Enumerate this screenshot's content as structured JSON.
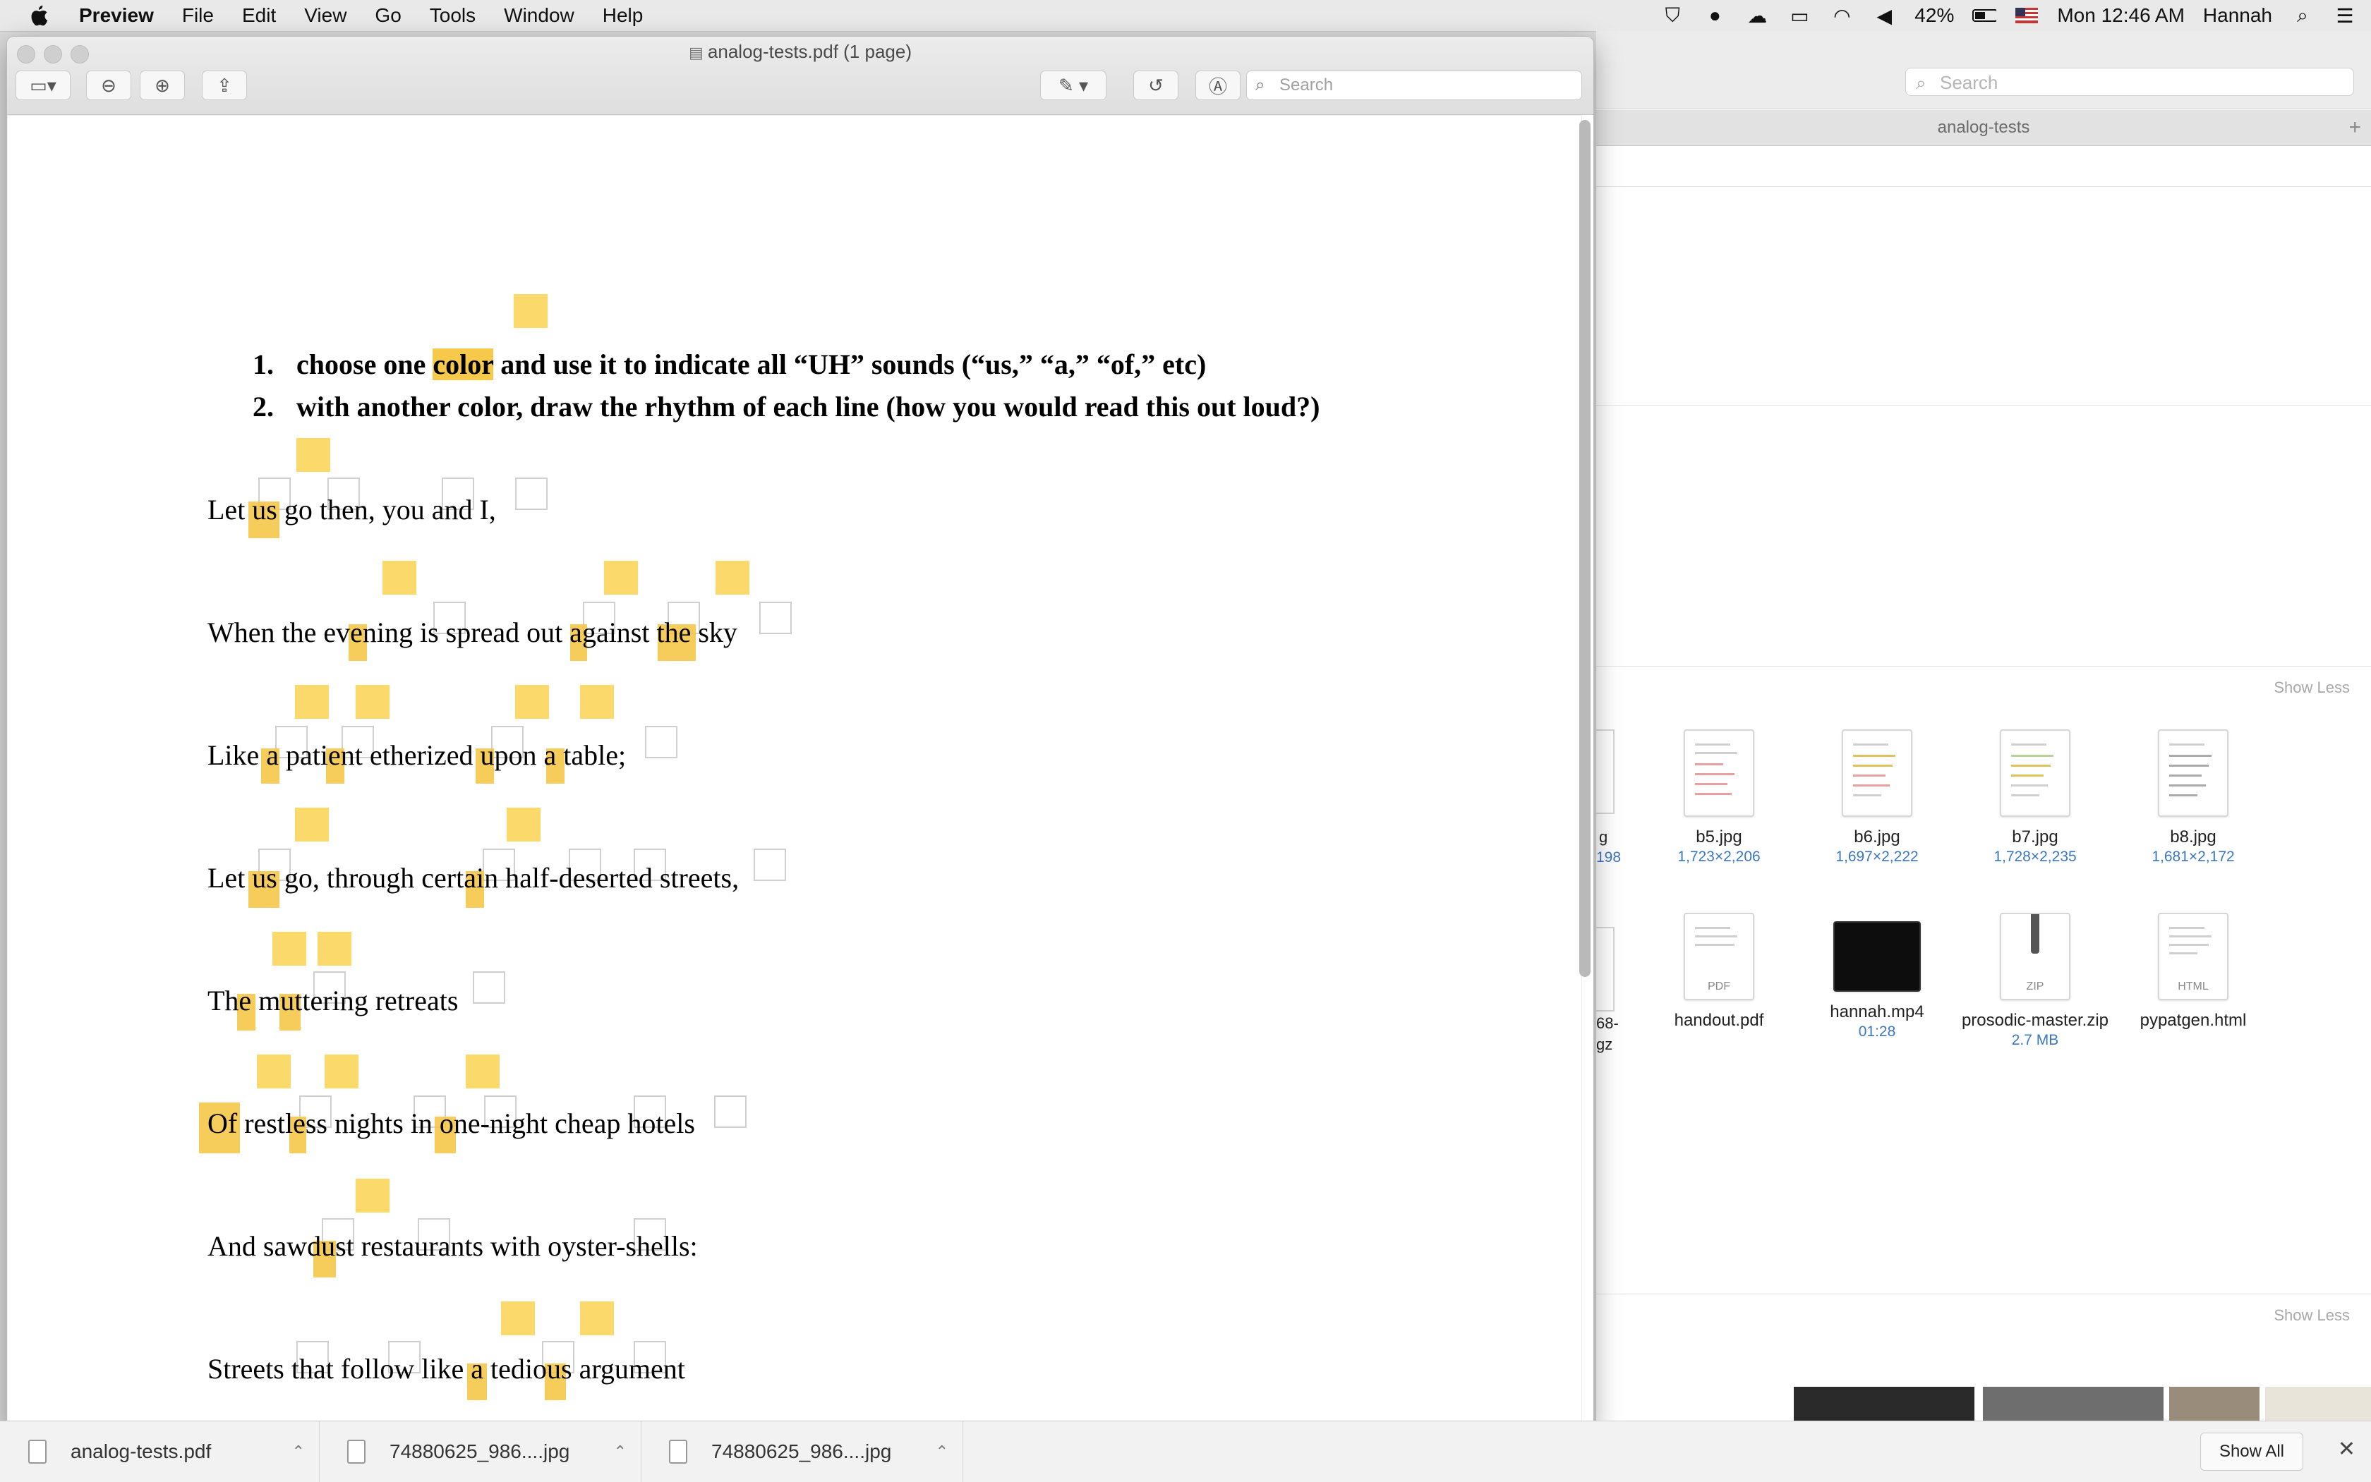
{
  "menubar": {
    "app_name": "Preview",
    "items": [
      "File",
      "Edit",
      "View",
      "Go",
      "Tools",
      "Window",
      "Help"
    ],
    "battery": "42%",
    "clock": "Mon 12:46 AM",
    "user": "Hannah"
  },
  "preview": {
    "title": "analog-tests.pdf (1 page)",
    "search_placeholder": "Search",
    "instructions": [
      {
        "num": "1.",
        "pre": "choose one ",
        "hl": "color",
        "post": " and use it to indicate all “UH” sounds (“us,” “a,” “of,” etc)"
      },
      {
        "num": "2.",
        "pre": "with another color, draw the rhythm of each line (how you would read this out loud?)",
        "hl": "",
        "post": ""
      }
    ],
    "poem_lines": [
      "Let us go then, you and I,",
      "When the evening is spread out against the sky",
      "Like a patient etherized upon a table;",
      "Let us go, through certain half-deserted streets,",
      "The muttering retreats",
      "Of restless nights in one-night cheap hotels",
      "And sawdust restaurants with oyster-shells:",
      "Streets that follow like a tedious argument"
    ]
  },
  "finder": {
    "search_placeholder": "Search",
    "tab_title": "analog-tests",
    "show_less_1": "Show Less",
    "show_less_2": "Show Less",
    "partial_meta": "198",
    "partial_name": "68-\ngz",
    "files_row1": [
      {
        "name": "b5.jpg",
        "meta": "1,723×2,206"
      },
      {
        "name": "b6.jpg",
        "meta": "1,697×2,222"
      },
      {
        "name": "b7.jpg",
        "meta": "1,728×2,235"
      },
      {
        "name": "b8.jpg",
        "meta": "1,681×2,172"
      }
    ],
    "files_row2": [
      {
        "name": "handout.pdf",
        "meta": "",
        "tag": "PDF"
      },
      {
        "name": "hannah.mp4",
        "meta": "01:28",
        "tag": ""
      },
      {
        "name": "prosodic-master.zip",
        "meta": "2.7 MB",
        "tag": "ZIP"
      },
      {
        "name": "pypatgen.html",
        "meta": "",
        "tag": "HTML"
      }
    ]
  },
  "downloads": {
    "items": [
      "analog-tests.pdf",
      "74880625_986....jpg",
      "74880625_986....jpg"
    ],
    "show_all": "Show All"
  }
}
